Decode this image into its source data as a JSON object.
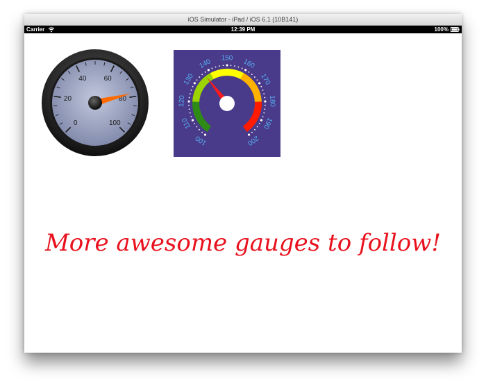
{
  "window": {
    "title": "iOS Simulator - iPad / iOS 6.1 (10B141)"
  },
  "status_bar": {
    "carrier": "Carrier",
    "time": "12:39 PM",
    "battery": "100%",
    "icons": [
      "wifi-icon",
      "battery-icon"
    ]
  },
  "gauges": [
    {
      "name": "dial-gauge",
      "min": 0,
      "max": 100,
      "ticks": [
        "0",
        "20",
        "40",
        "60",
        "80",
        "100"
      ],
      "value": 78,
      "needle_color": "#ff6a00",
      "face_color": "#8a94b6"
    },
    {
      "name": "speedometer-gauge",
      "min": 100,
      "max": 200,
      "ticks": [
        "100",
        "110",
        "120",
        "130",
        "140",
        "150",
        "160",
        "170",
        "180",
        "190",
        "200"
      ],
      "value": 137,
      "background_color": "#4a3a8a",
      "label_color": "#55aef0",
      "needle_color": "#ff1a1a",
      "band_colors": [
        "#2e8c16",
        "#9bd400",
        "#ffff00",
        "#ffb200",
        "#ff1a00"
      ]
    }
  ],
  "message": "More awesome gauges to follow!"
}
